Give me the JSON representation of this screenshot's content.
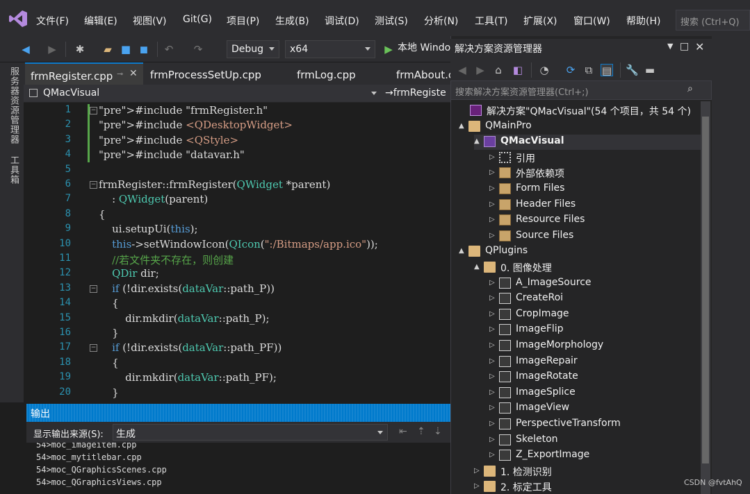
{
  "menu": {
    "items": [
      "文件(F)",
      "编辑(E)",
      "视图(V)",
      "Git(G)",
      "项目(P)",
      "生成(B)",
      "调试(D)",
      "测试(S)",
      "分析(N)",
      "工具(T)",
      "扩展(X)",
      "窗口(W)",
      "帮助(H)"
    ],
    "search_placeholder": "搜索 (Ctrl+Q)"
  },
  "toolbar": {
    "config": "Debug",
    "platform": "x64",
    "run_label": "本地 Windo"
  },
  "side_strip": {
    "items": [
      "服务器资源管理器",
      "工具箱"
    ]
  },
  "tabs": [
    {
      "label": "frmRegister.cpp",
      "active": true
    },
    {
      "label": "frmProcessSetUp.cpp"
    },
    {
      "label": "frmLog.cpp"
    },
    {
      "label": "frmAbout.c"
    }
  ],
  "navbar": {
    "scope": "QMacVisual",
    "member": "→frmRegiste"
  },
  "editor": {
    "line_numbers": [
      "1",
      "2",
      "3",
      "4",
      "5",
      "6",
      "7",
      "8",
      "9",
      "10",
      "11",
      "12",
      "13",
      "14",
      "15",
      "16",
      "17",
      "18",
      "19",
      "20"
    ],
    "lines": [
      "#include \"frmRegister.h\"",
      "#include <QDesktopWidget>",
      "#include <QStyle>",
      "#include \"datavar.h\"",
      "",
      "frmRegister::frmRegister(QWidget *parent)",
      "    : QWidget(parent)",
      "{",
      "    ui.setupUi(this);",
      "    this->setWindowIcon(QIcon(\":/Bitmaps/app.ico\"));",
      "    //若文件夹不存在，则创建",
      "    QDir dir;",
      "    if (!dir.exists(dataVar::path_P))",
      "    {",
      "        dir.mkdir(dataVar::path_P);",
      "    }",
      "    if (!dir.exists(dataVar::path_PF))",
      "    {",
      "        dir.mkdir(dataVar::path_PF);",
      "    }"
    ]
  },
  "output": {
    "title": "输出",
    "source_label": "显示输出来源(S):",
    "source_value": "生成",
    "lines": [
      "54>moc_imageitem.cpp",
      "54>moc_mytitlebar.cpp",
      "54>moc_QGraphicsScenes.cpp",
      "54>moc_QGraphicsViews.cpp"
    ]
  },
  "solution_explorer": {
    "title": "解决方案资源管理器",
    "search_placeholder": "搜索解决方案资源管理器(Ctrl+;)",
    "nodes": [
      {
        "label": "解决方案\"QMacVisual\"(54 个项目，共 54 个)",
        "level": 0,
        "icon": "solution-icon",
        "arrow": ""
      },
      {
        "label": "QMainPro",
        "level": 1,
        "icon": "folder-icon",
        "arrow": "▲"
      },
      {
        "label": "QMacVisual",
        "level": 2,
        "icon": "project-icon",
        "arrow": "▲",
        "bold": true
      },
      {
        "label": "引用",
        "level": 3,
        "icon": "references-icon",
        "arrow": "▷"
      },
      {
        "label": "外部依赖项",
        "level": 3,
        "icon": "filter-icon",
        "arrow": "▷"
      },
      {
        "label": "Form Files",
        "level": 3,
        "icon": "filter-icon",
        "arrow": "▷"
      },
      {
        "label": "Header Files",
        "level": 3,
        "icon": "filter-icon",
        "arrow": "▷"
      },
      {
        "label": "Resource Files",
        "level": 3,
        "icon": "filter-icon",
        "arrow": "▷"
      },
      {
        "label": "Source Files",
        "level": 3,
        "icon": "filter-icon",
        "arrow": "▷"
      },
      {
        "label": "QPlugins",
        "level": 1,
        "icon": "folder-icon",
        "arrow": "▲"
      },
      {
        "label": "0. 图像处理",
        "level": 2,
        "icon": "folder-icon",
        "arrow": "▲"
      },
      {
        "label": "A_ImageSource",
        "level": 3,
        "icon": "plugin-project-icon",
        "arrow": "▷"
      },
      {
        "label": "CreateRoi",
        "level": 3,
        "icon": "plugin-project-icon",
        "arrow": "▷"
      },
      {
        "label": "CropImage",
        "level": 3,
        "icon": "plugin-project-icon",
        "arrow": "▷"
      },
      {
        "label": "ImageFlip",
        "level": 3,
        "icon": "plugin-project-icon",
        "arrow": "▷"
      },
      {
        "label": "ImageMorphology",
        "level": 3,
        "icon": "plugin-project-icon",
        "arrow": "▷"
      },
      {
        "label": "ImageRepair",
        "level": 3,
        "icon": "plugin-project-icon",
        "arrow": "▷"
      },
      {
        "label": "ImageRotate",
        "level": 3,
        "icon": "plugin-project-icon",
        "arrow": "▷"
      },
      {
        "label": "ImageSplice",
        "level": 3,
        "icon": "plugin-project-icon",
        "arrow": "▷"
      },
      {
        "label": "ImageView",
        "level": 3,
        "icon": "plugin-project-icon",
        "arrow": "▷"
      },
      {
        "label": "PerspectiveTransform",
        "level": 3,
        "icon": "plugin-project-icon",
        "arrow": "▷"
      },
      {
        "label": "Skeleton",
        "level": 3,
        "icon": "plugin-project-icon",
        "arrow": "▷"
      },
      {
        "label": "Z_ExportImage",
        "level": 3,
        "icon": "plugin-project-icon",
        "arrow": "▷"
      },
      {
        "label": "1. 检测识别",
        "level": 2,
        "icon": "folder-icon",
        "arrow": "▷"
      },
      {
        "label": "2. 标定工具",
        "level": 2,
        "icon": "folder-icon",
        "arrow": "▷"
      }
    ]
  },
  "watermark": "CSDN @fvtAhQ",
  "colors": {
    "accent": "#007acc",
    "background": "#1e1e1e",
    "chrome": "#2d2d30",
    "keyword": "#569cd6",
    "string": "#d69d85",
    "comment": "#57a64a",
    "line_number": "#2b91af"
  }
}
